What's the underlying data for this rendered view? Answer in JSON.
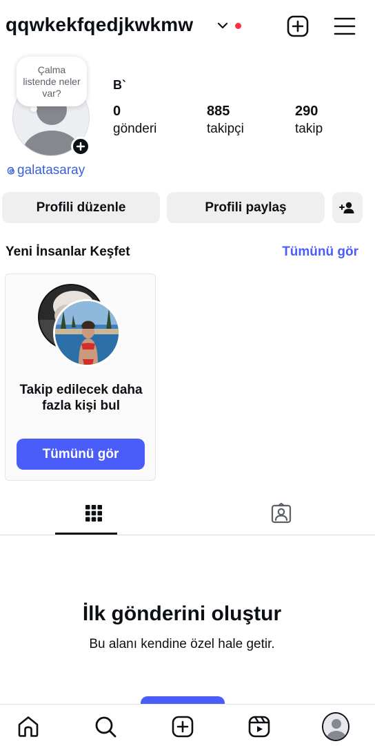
{
  "header": {
    "username": "qqwkekfqedjkwkmw",
    "notification_color": "#ff3040"
  },
  "profile": {
    "note": "Çalma listende neler var?",
    "display_name": "B`",
    "stats": {
      "posts_count": "0",
      "posts_label": "gönderi",
      "followers_count": "885",
      "followers_label": "takipçi",
      "following_count": "290",
      "following_label": "takip"
    },
    "threads_handle": "galatasaray"
  },
  "actions": {
    "edit_label": "Profili düzenle",
    "share_label": "Profili paylaş"
  },
  "discover": {
    "title": "Yeni İnsanlar Keşfet",
    "see_all": "Tümünü gör",
    "card_text": "Takip edilecek daha fazla kişi bul",
    "card_button": "Tümünü gör"
  },
  "empty_state": {
    "title": "İlk gönderini oluştur",
    "subtitle": "Bu alanı kendine özel hale getir."
  },
  "colors": {
    "accent": "#4a5df9",
    "link": "#3b5fd8",
    "button_bg": "#efefef"
  },
  "icons": {
    "header": [
      "chevron-down-icon",
      "new-post-icon",
      "menu-icon"
    ],
    "tabs": [
      "grid-icon",
      "tagged-icon"
    ],
    "nav": [
      "home-icon",
      "search-icon",
      "create-icon",
      "reels-icon",
      "profile-icon"
    ]
  }
}
